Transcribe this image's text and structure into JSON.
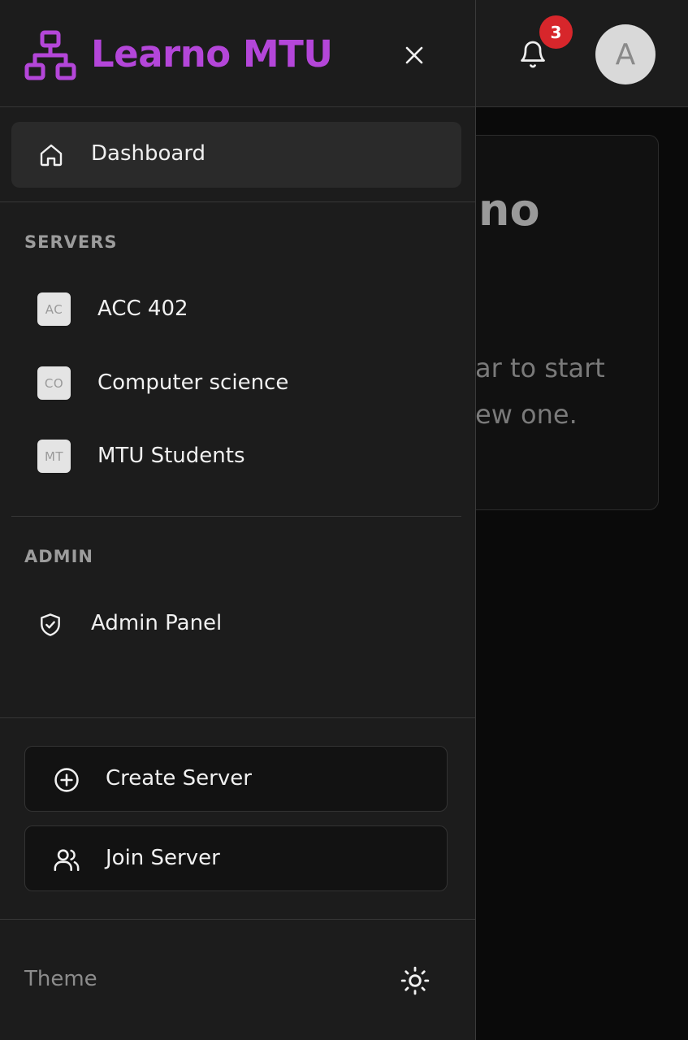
{
  "app": {
    "brand": "Learno MTU",
    "brand_color": "#b446d9"
  },
  "header": {
    "notification_count": "3",
    "avatar_initial": "A"
  },
  "background": {
    "heading_fragment": "no",
    "text_line_1": "ar to start",
    "text_line_2": "ew one."
  },
  "drawer": {
    "dashboard_label": "Dashboard",
    "servers_heading": "SERVERS",
    "servers": [
      {
        "initials": "AC",
        "name": "ACC 402"
      },
      {
        "initials": "CO",
        "name": "Computer science"
      },
      {
        "initials": "MT",
        "name": "MTU Students"
      }
    ],
    "admin_heading": "ADMIN",
    "admin_panel_label": "Admin Panel",
    "create_server_label": "Create Server",
    "join_server_label": "Join Server",
    "theme_label": "Theme"
  },
  "icons": {
    "logo": "sitemap-icon",
    "close": "close-icon",
    "bell": "bell-icon",
    "dashboard": "home-icon",
    "admin": "shield-check-icon",
    "create": "plus-circle-icon",
    "join": "users-icon",
    "theme": "sun-icon"
  }
}
